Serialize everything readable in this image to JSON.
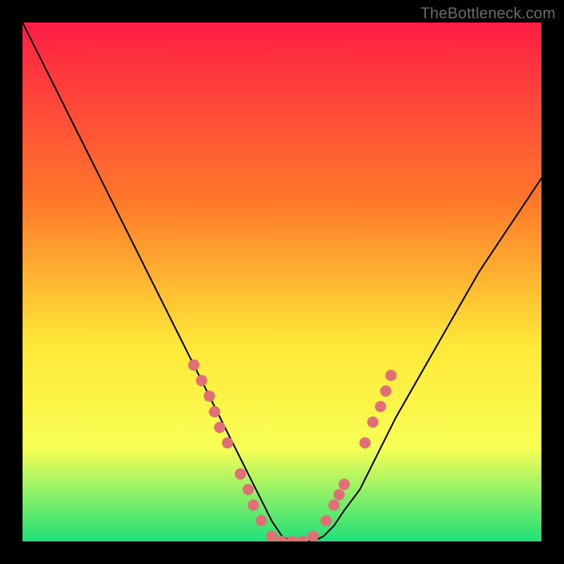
{
  "watermark": "TheBottleneck.com",
  "chart_data": {
    "type": "line",
    "title": "",
    "xlabel": "",
    "ylabel": "",
    "xlim": [
      0,
      100
    ],
    "ylim": [
      0,
      100
    ],
    "grid": false,
    "legend": false,
    "background_gradient": {
      "top": "#ff1e46",
      "mid_upper": "#ff7a2a",
      "mid": "#ffe838",
      "mid_lower": "#f8ff55",
      "bottom": "#1fe07a"
    },
    "series": [
      {
        "name": "curve",
        "color": "#000000",
        "x": [
          0,
          3,
          6,
          9,
          12,
          15,
          18,
          21,
          24,
          27,
          30,
          33,
          36,
          39,
          42,
          44,
          46,
          48,
          50,
          52,
          54,
          56,
          58,
          60,
          62,
          65,
          68,
          72,
          76,
          80,
          84,
          88,
          92,
          96,
          100
        ],
        "values": [
          100,
          94,
          88,
          82,
          76,
          70,
          64,
          58,
          52,
          46,
          40,
          34,
          28,
          22,
          16,
          12,
          8,
          4,
          1,
          0,
          0,
          0,
          1,
          3,
          6,
          10,
          16,
          24,
          31,
          38,
          45,
          52,
          58,
          64,
          70
        ]
      }
    ],
    "markers": {
      "name": "dots",
      "color": "#e07075",
      "radius_px": 8,
      "points": [
        {
          "x": 33,
          "y": 34
        },
        {
          "x": 34.5,
          "y": 31
        },
        {
          "x": 36,
          "y": 28
        },
        {
          "x": 37,
          "y": 25
        },
        {
          "x": 38,
          "y": 22
        },
        {
          "x": 39.5,
          "y": 19
        },
        {
          "x": 42,
          "y": 13
        },
        {
          "x": 43.5,
          "y": 10
        },
        {
          "x": 44.5,
          "y": 7
        },
        {
          "x": 46,
          "y": 4
        },
        {
          "x": 48,
          "y": 1
        },
        {
          "x": 50,
          "y": 0
        },
        {
          "x": 52,
          "y": 0
        },
        {
          "x": 54,
          "y": 0
        },
        {
          "x": 56,
          "y": 1
        },
        {
          "x": 58.5,
          "y": 4
        },
        {
          "x": 60,
          "y": 7
        },
        {
          "x": 61,
          "y": 9
        },
        {
          "x": 62,
          "y": 11
        },
        {
          "x": 66,
          "y": 19
        },
        {
          "x": 67.5,
          "y": 23
        },
        {
          "x": 69,
          "y": 26
        },
        {
          "x": 70,
          "y": 29
        },
        {
          "x": 71,
          "y": 32
        }
      ]
    }
  }
}
